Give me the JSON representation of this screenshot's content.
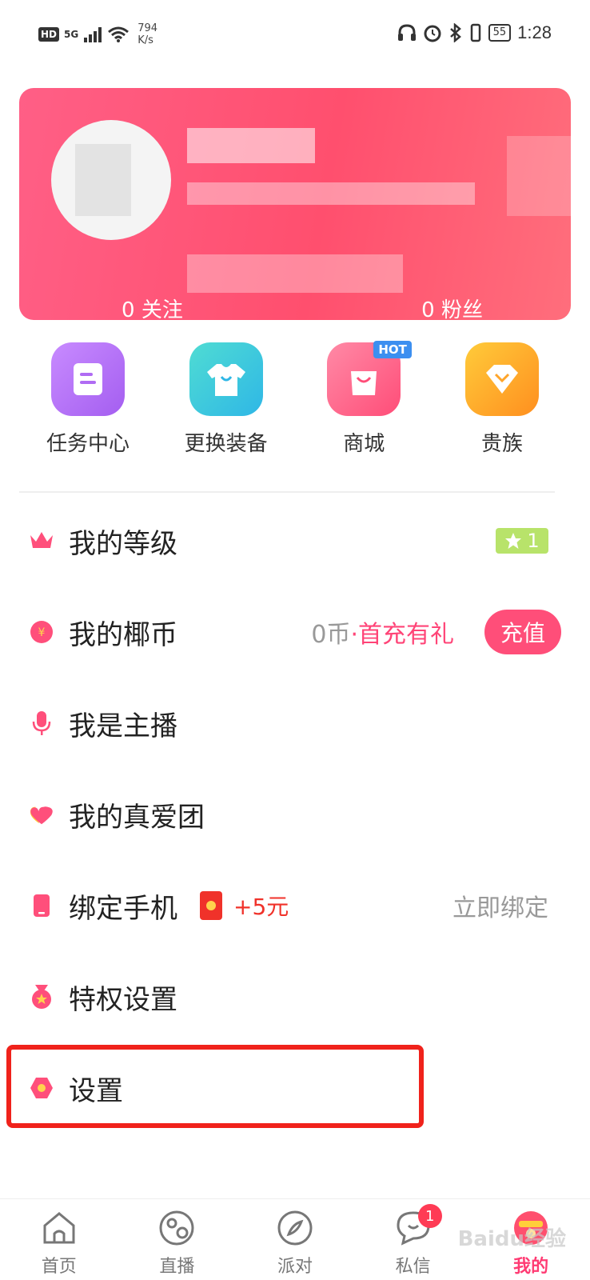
{
  "status_bar": {
    "hd": "HD",
    "signal": "5G",
    "net_speed_value": "794",
    "net_speed_unit": "K/s",
    "battery": "55",
    "time": "1:28"
  },
  "profile": {
    "following_count": "0",
    "following_label": "关注",
    "fans_count": "0",
    "fans_label": "粉丝"
  },
  "shortcuts": [
    {
      "label": "任务中心",
      "icon": "task-center-icon",
      "color": "#b972f5"
    },
    {
      "label": "更换装备",
      "icon": "tshirt-icon",
      "color": "#3fd0d6"
    },
    {
      "label": "商城",
      "icon": "shopping-bag-icon",
      "color": "#ff5f83",
      "badge": "HOT"
    },
    {
      "label": "贵族",
      "icon": "diamond-icon",
      "color": "#ffaa2b"
    }
  ],
  "menu": {
    "level": {
      "label": "我的等级",
      "badge": "1"
    },
    "coins": {
      "label": "我的椰币",
      "amount": "0币",
      "separator": "·",
      "promo": "首充有礼",
      "button": "充值"
    },
    "anchor": {
      "label": "我是主播"
    },
    "true_love": {
      "label": "我的真爱团"
    },
    "bind_phone": {
      "label": "绑定手机",
      "bonus": "+5元",
      "action": "立即绑定"
    },
    "privilege": {
      "label": "特权设置"
    },
    "settings": {
      "label": "设置"
    }
  },
  "bottom_nav": [
    {
      "label": "首页",
      "icon": "home-icon"
    },
    {
      "label": "直播",
      "icon": "live-icon"
    },
    {
      "label": "派对",
      "icon": "party-compass-icon"
    },
    {
      "label": "私信",
      "icon": "message-icon",
      "badge": "1"
    },
    {
      "label": "我的",
      "icon": "me-icon",
      "active": true
    }
  ],
  "watermark": "Baidu经验",
  "colors": {
    "accent": "#ff4e79",
    "highlight": "#f0221b"
  }
}
